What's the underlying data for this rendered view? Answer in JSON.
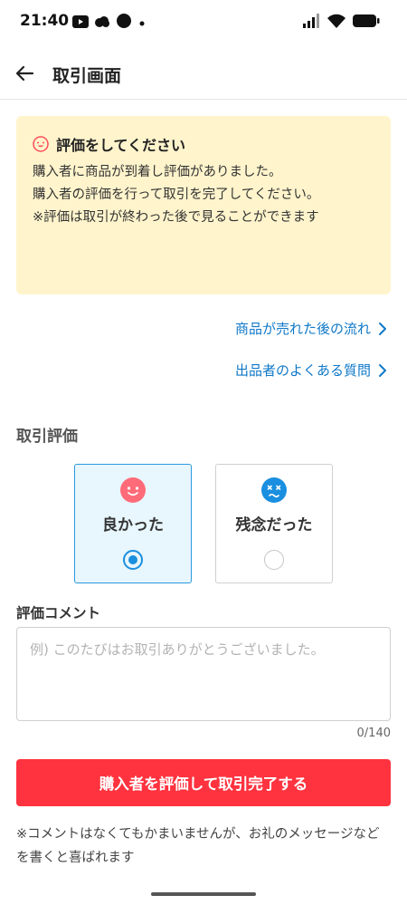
{
  "status_bar": {
    "time": "21:40",
    "left_icons": [
      "youtube-icon",
      "cloud-icon",
      "circle-icon",
      "dot-icon"
    ],
    "right_icons": [
      "signal-icon",
      "wifi-icon",
      "battery-icon"
    ]
  },
  "header": {
    "back_icon": "arrow-left-icon",
    "title": "取引画面"
  },
  "notice": {
    "icon": "smile-face-icon",
    "title": "評価をしてください",
    "lines": [
      "購入者に商品が到着し評価がありました。",
      "購入者の評価を行って取引を完了してください。",
      "※評価は取引が終わった後で見ることができます"
    ]
  },
  "links": [
    {
      "label": "商品が売れた後の流れ",
      "icon": "chevron-right-icon"
    },
    {
      "label": "出品者のよくある質問",
      "icon": "chevron-right-icon"
    }
  ],
  "rating": {
    "heading": "取引評価",
    "options": [
      {
        "label": "良かった",
        "icon": "happy-face-icon",
        "selected": true
      },
      {
        "label": "残念だった",
        "icon": "sad-face-icon",
        "selected": false
      }
    ]
  },
  "comment": {
    "label": "評価コメント",
    "value": "",
    "placeholder": "例) このたびはお取引ありがとうございました。",
    "counter": "0/140"
  },
  "submit": {
    "label": "購入者を評価して取引完了する"
  },
  "footnote": "※コメントはなくてもかまいませんが、お礼のメッセージなどを書くと喜ばれます",
  "colors": {
    "accent_blue": "#0f78c8",
    "radio_blue": "#1a8fe0",
    "primary_red": "#ff333f",
    "notice_bg": "#fff4cc",
    "happy_face": "#ff6b78",
    "sad_face": "#1a8fe0"
  }
}
